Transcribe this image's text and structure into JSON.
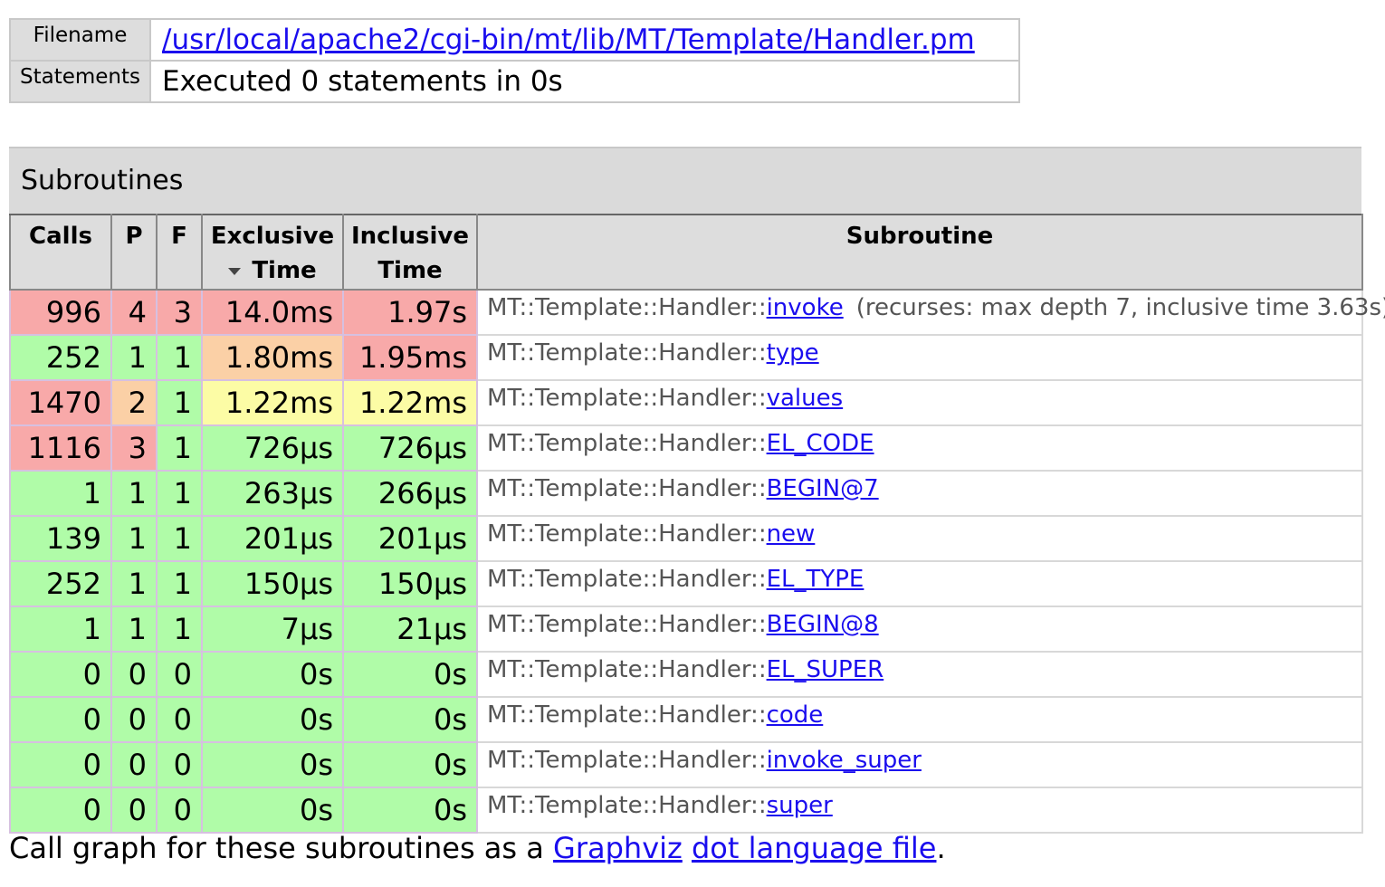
{
  "file_info": {
    "filename_label": "Filename",
    "filename_value": "/usr/local/apache2/cgi-bin/mt/lib/MT/Template/Handler.pm",
    "statements_label": "Statements",
    "statements_value": "Executed 0 statements in 0s"
  },
  "subroutines": {
    "caption": "Subroutines",
    "headers": {
      "calls": "Calls",
      "p": "P",
      "f": "F",
      "exclusive_time_line1": "Exclusive",
      "exclusive_time_line2": "Time",
      "inclusive_time_line1": "Inclusive",
      "inclusive_time_line2": "Time",
      "subroutine": "Subroutine"
    },
    "rows": [
      {
        "calls": "996",
        "p": "4",
        "f": "3",
        "excl": "14.0ms",
        "incl": "1.97s",
        "pkg": "MT::Template::Handler::",
        "name": "invoke",
        "extra": "(recurses: max depth 7, inclusive time 3.63s)",
        "c_calls": "red",
        "c_p": "red",
        "c_f": "red",
        "c_excl": "red",
        "c_incl": "red"
      },
      {
        "calls": "252",
        "p": "1",
        "f": "1",
        "excl": "1.80ms",
        "incl": "1.95ms",
        "pkg": "MT::Template::Handler::",
        "name": "type",
        "extra": "",
        "c_calls": "green",
        "c_p": "green",
        "c_f": "green",
        "c_excl": "orange",
        "c_incl": "red"
      },
      {
        "calls": "1470",
        "p": "2",
        "f": "1",
        "excl": "1.22ms",
        "incl": "1.22ms",
        "pkg": "MT::Template::Handler::",
        "name": "values",
        "extra": "",
        "c_calls": "red",
        "c_p": "orange",
        "c_f": "green",
        "c_excl": "yellow",
        "c_incl": "yellow"
      },
      {
        "calls": "1116",
        "p": "3",
        "f": "1",
        "excl": "726µs",
        "incl": "726µs",
        "pkg": "MT::Template::Handler::",
        "name": "EL_CODE",
        "extra": "",
        "c_calls": "red",
        "c_p": "red",
        "c_f": "green",
        "c_excl": "green",
        "c_incl": "green"
      },
      {
        "calls": "1",
        "p": "1",
        "f": "1",
        "excl": "263µs",
        "incl": "266µs",
        "pkg": "MT::Template::Handler::",
        "name": "BEGIN@7",
        "extra": "",
        "c_calls": "green",
        "c_p": "green",
        "c_f": "green",
        "c_excl": "green",
        "c_incl": "green"
      },
      {
        "calls": "139",
        "p": "1",
        "f": "1",
        "excl": "201µs",
        "incl": "201µs",
        "pkg": "MT::Template::Handler::",
        "name": "new",
        "extra": "",
        "c_calls": "green",
        "c_p": "green",
        "c_f": "green",
        "c_excl": "green",
        "c_incl": "green"
      },
      {
        "calls": "252",
        "p": "1",
        "f": "1",
        "excl": "150µs",
        "incl": "150µs",
        "pkg": "MT::Template::Handler::",
        "name": "EL_TYPE",
        "extra": "",
        "c_calls": "green",
        "c_p": "green",
        "c_f": "green",
        "c_excl": "green",
        "c_incl": "green"
      },
      {
        "calls": "1",
        "p": "1",
        "f": "1",
        "excl": "7µs",
        "incl": "21µs",
        "pkg": "MT::Template::Handler::",
        "name": "BEGIN@8",
        "extra": "",
        "c_calls": "green",
        "c_p": "green",
        "c_f": "green",
        "c_excl": "green",
        "c_incl": "green"
      },
      {
        "calls": "0",
        "p": "0",
        "f": "0",
        "excl": "0s",
        "incl": "0s",
        "pkg": "MT::Template::Handler::",
        "name": "EL_SUPER",
        "extra": "",
        "c_calls": "green",
        "c_p": "green",
        "c_f": "green",
        "c_excl": "green",
        "c_incl": "green"
      },
      {
        "calls": "0",
        "p": "0",
        "f": "0",
        "excl": "0s",
        "incl": "0s",
        "pkg": "MT::Template::Handler::",
        "name": "code",
        "extra": "",
        "c_calls": "green",
        "c_p": "green",
        "c_f": "green",
        "c_excl": "green",
        "c_incl": "green"
      },
      {
        "calls": "0",
        "p": "0",
        "f": "0",
        "excl": "0s",
        "incl": "0s",
        "pkg": "MT::Template::Handler::",
        "name": "invoke_super",
        "extra": "",
        "c_calls": "green",
        "c_p": "green",
        "c_f": "green",
        "c_excl": "green",
        "c_incl": "green"
      },
      {
        "calls": "0",
        "p": "0",
        "f": "0",
        "excl": "0s",
        "incl": "0s",
        "pkg": "MT::Template::Handler::",
        "name": "super",
        "extra": "",
        "c_calls": "green",
        "c_p": "green",
        "c_f": "green",
        "c_excl": "green",
        "c_incl": "green"
      }
    ]
  },
  "footer": {
    "prefix": "Call graph for these subroutines as a ",
    "link1": "Graphviz",
    "space": " ",
    "link2": "dot language file",
    "suffix": "."
  },
  "colors": {
    "red": "#f8a9a9",
    "orange": "#fbd0a6",
    "yellow": "#fcfca5",
    "green": "#b0fca8",
    "link": "#1a0dee"
  }
}
